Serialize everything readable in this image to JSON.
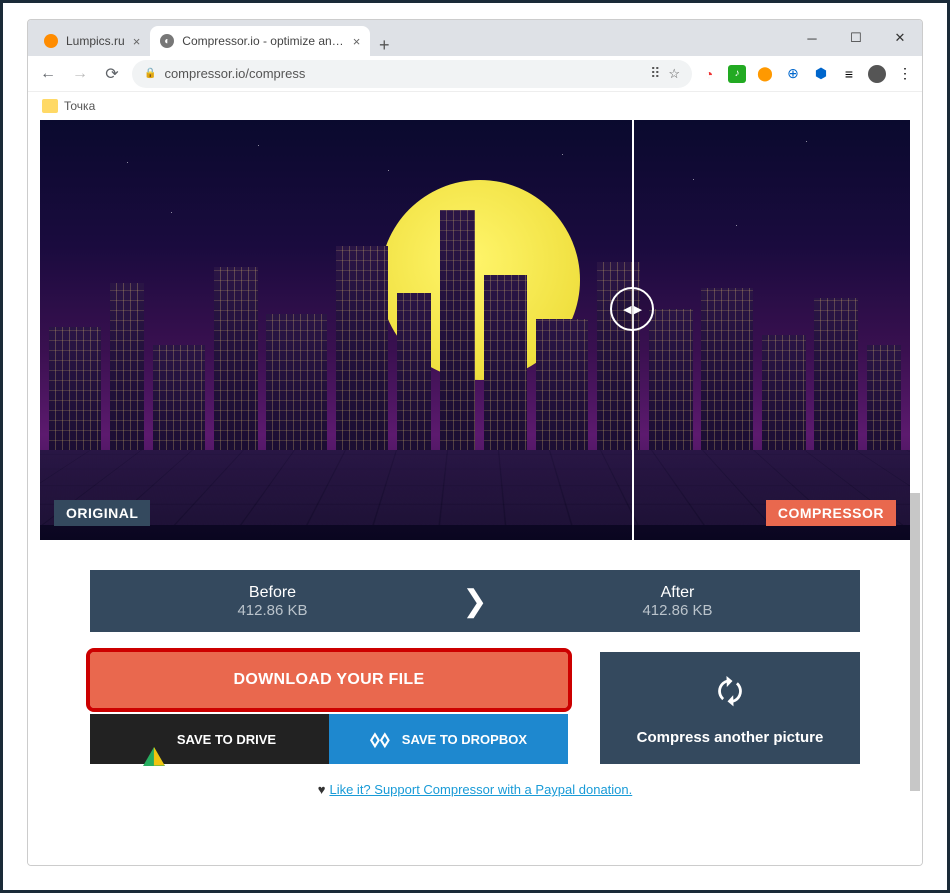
{
  "window": {
    "tabs": [
      {
        "title": "Lumpics.ru",
        "active": false
      },
      {
        "title": "Compressor.io - optimize and co",
        "active": true
      }
    ]
  },
  "address": {
    "url": "compressor.io/compress"
  },
  "bookmarks": {
    "item1": "Точка"
  },
  "compare": {
    "left_label": "ORIGINAL",
    "right_label": "COMPRESSOR"
  },
  "stats": {
    "before_label": "Before",
    "before_value": "412.86 KB",
    "after_label": "After",
    "after_value": "412.86 KB"
  },
  "actions": {
    "download": "DOWNLOAD YOUR FILE",
    "save_drive": "SAVE TO DRIVE",
    "save_dropbox": "SAVE TO DROPBOX",
    "another": "Compress another picture"
  },
  "footer": {
    "link": "Like it? Support Compressor with a Paypal donation."
  }
}
